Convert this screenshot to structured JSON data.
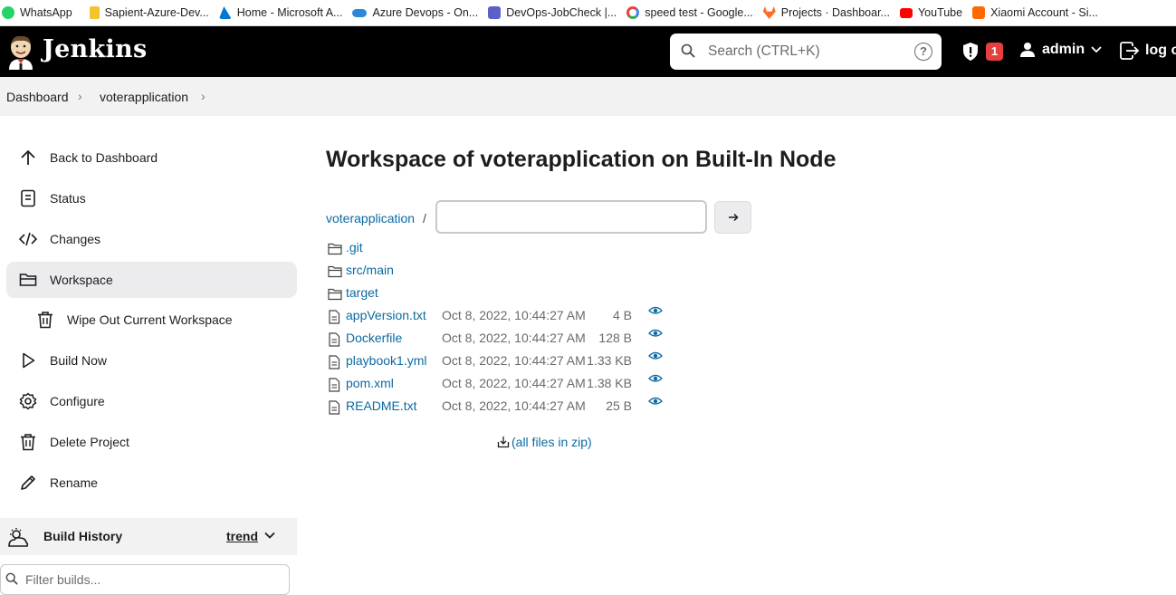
{
  "bookmarks": [
    {
      "label": "WhatsApp",
      "color": "#25d366"
    },
    {
      "label": "Sapient-Azure-Dev...",
      "color": "#f4c430"
    },
    {
      "label": "Home - Microsoft A...",
      "color": "#0078d4"
    },
    {
      "label": "Azure Devops - On...",
      "color": "#2b88d8"
    },
    {
      "label": "DevOps-JobCheck |...",
      "color": "#5b5fc7"
    },
    {
      "label": "speed test - Google...",
      "color": "#ea4335"
    },
    {
      "label": "Projects · Dashboar...",
      "color": "#fc6d26"
    },
    {
      "label": "YouTube",
      "color": "#ff0000"
    },
    {
      "label": "Xiaomi Account - Si...",
      "color": "#ff6900"
    }
  ],
  "header": {
    "brand": "Jenkins",
    "search_placeholder": "Search (CTRL+K)",
    "help": "?",
    "security_count": "1",
    "user": "admin",
    "logout": "log out"
  },
  "breadcrumb": [
    "Dashboard",
    "voterapplication"
  ],
  "sidebar": [
    {
      "label": "Back to Dashboard",
      "icon": "arrow-up-icon"
    },
    {
      "label": "Status",
      "icon": "document-icon"
    },
    {
      "label": "Changes",
      "icon": "code-icon"
    },
    {
      "label": "Workspace",
      "icon": "folder-icon",
      "active": true
    },
    {
      "label": "Wipe Out Current Workspace",
      "icon": "trash-icon",
      "sub": true
    },
    {
      "label": "Build Now",
      "icon": "play-icon"
    },
    {
      "label": "Configure",
      "icon": "gear-icon"
    },
    {
      "label": "Delete Project",
      "icon": "trash-icon"
    },
    {
      "label": "Rename",
      "icon": "pencil-icon"
    }
  ],
  "build_history": {
    "title": "Build History",
    "trend": "trend",
    "filter_placeholder": "Filter builds..."
  },
  "main": {
    "title": "Workspace of voterapplication on Built-In Node",
    "path_root": "voterapplication",
    "path_sep": "/",
    "path_value": "",
    "folders": [
      ".git",
      "src/main",
      "target"
    ],
    "files": [
      {
        "name": "appVersion.txt",
        "date": "Oct 8, 2022, 10:44:27 AM",
        "size": "4 B"
      },
      {
        "name": "Dockerfile",
        "date": "Oct 8, 2022, 10:44:27 AM",
        "size": "128 B"
      },
      {
        "name": "playbook1.yml",
        "date": "Oct 8, 2022, 10:44:27 AM",
        "size": "1.33 KB"
      },
      {
        "name": "pom.xml",
        "date": "Oct 8, 2022, 10:44:27 AM",
        "size": "1.38 KB"
      },
      {
        "name": "README.txt",
        "date": "Oct 8, 2022, 10:44:27 AM",
        "size": "25 B"
      }
    ],
    "zip_label": "(all files in zip)"
  }
}
